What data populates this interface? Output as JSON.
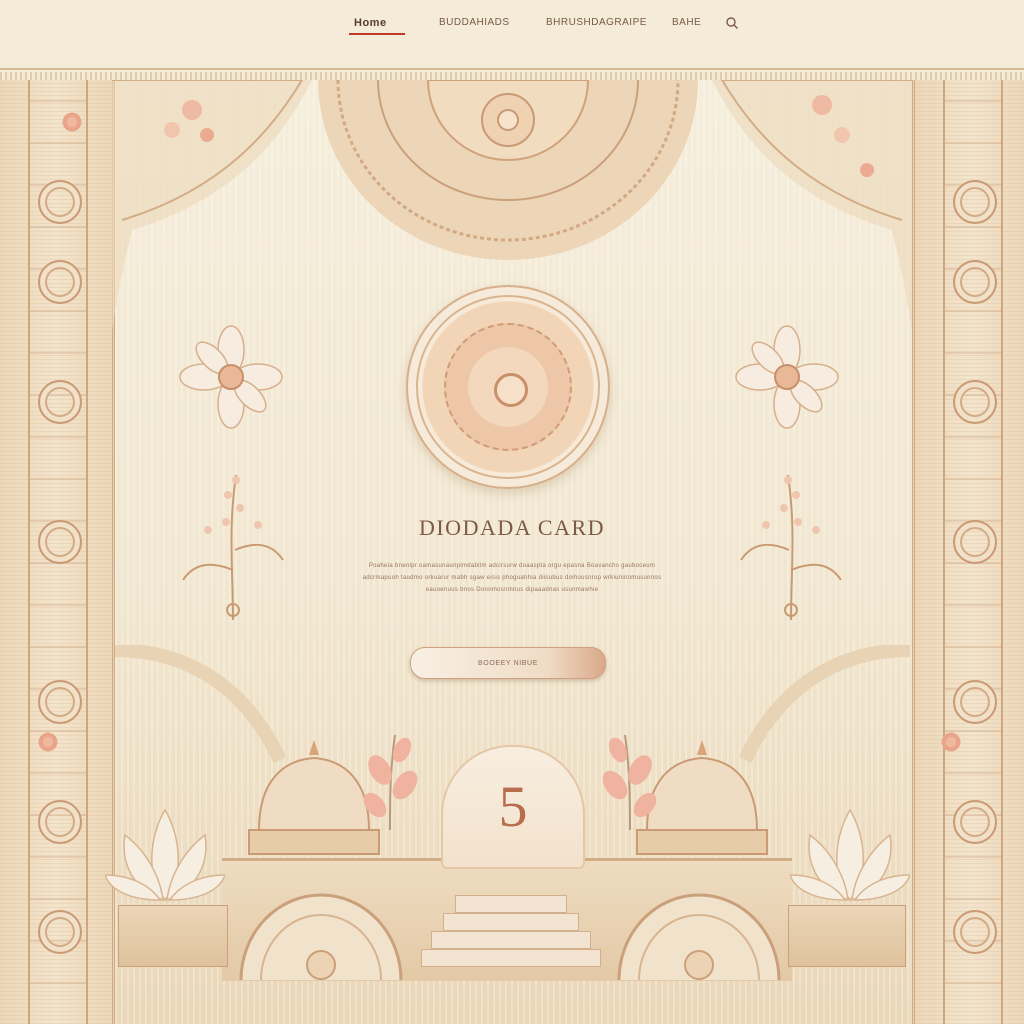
{
  "nav": {
    "items": [
      {
        "label": "Home",
        "active": true
      },
      {
        "label": "BUDDAHIADS"
      },
      {
        "label": "BHRUSHDAGRAIPE"
      },
      {
        "label": "BAHE"
      }
    ],
    "search_icon": "search-icon"
  },
  "card": {
    "title": "DIODADA CARD",
    "description": "Poaheia bnenlpr oamasunaunpimdabilm adcirsurw doaaspta orgu epasna Boavanchs gauboceum adcrmapuoh taudmo orkuarur mabh sgaw eisis phoguahhia diisubus doihousnrop wrkiuninomusunnos eauoenuus bnos Donnmosnmnus dipaaadnas usunmawhie",
    "cta_label": "BOOEEY NIBUE",
    "badge_number": "5"
  },
  "colors": {
    "accent": "#c0392b",
    "gold": "#cda882",
    "blush": "#e9a48a",
    "cream": "#f4ecd8"
  }
}
